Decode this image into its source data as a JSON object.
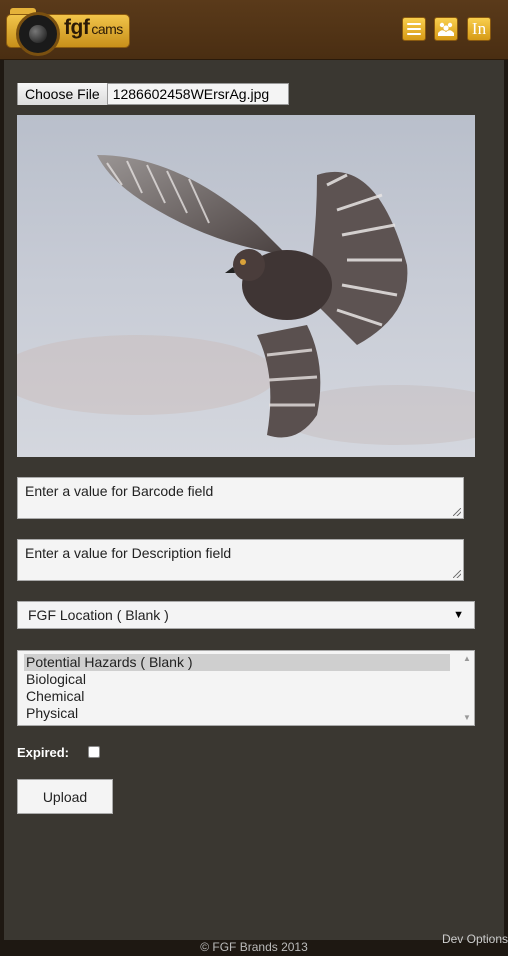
{
  "header": {
    "logo_text": "fgf",
    "logo_subtext": "cams",
    "icons": [
      "menu-icon",
      "users-icon",
      "linkedin-icon"
    ],
    "linkedin_glyph": "In"
  },
  "form": {
    "choose_file_label": "Choose File",
    "file_name": "1286602458WErsrAg.jpg",
    "barcode_placeholder": "Enter a value for Barcode field",
    "description_placeholder": "Enter a value for Description field",
    "location_select": "FGF Location ( Blank )",
    "hazards_options": [
      "Potential Hazards ( Blank )",
      "Biological",
      "Chemical",
      "Physical"
    ],
    "hazards_selected": "Potential Hazards ( Blank )",
    "expired_label": "Expired:",
    "expired_checked": false,
    "upload_label": "Upload"
  },
  "footer": {
    "copyright": "© FGF Brands 2013",
    "dev_options": "Dev Options"
  },
  "colors": {
    "header_brown": "#4a2e12",
    "accent_gold": "#e5b23a",
    "panel": "#3a3731"
  }
}
